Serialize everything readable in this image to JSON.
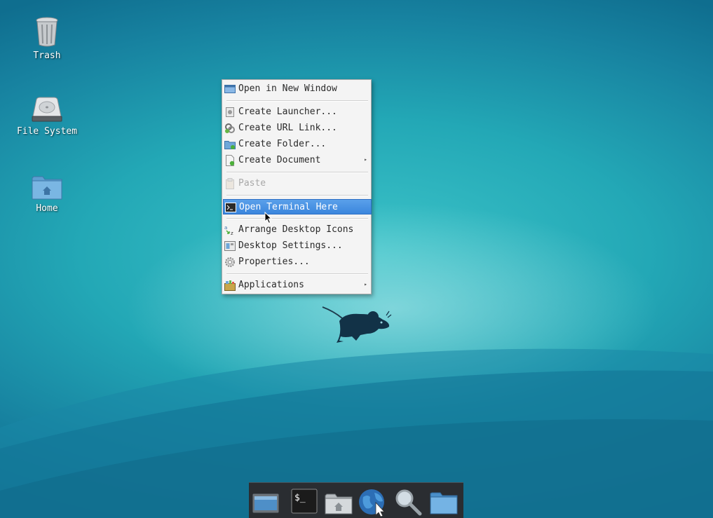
{
  "desktop_icons": [
    {
      "label": "Trash",
      "icon": "trash-icon"
    },
    {
      "label": "File System",
      "icon": "hard-drive-icon"
    },
    {
      "label": "Home",
      "icon": "home-folder-icon"
    }
  ],
  "context_menu": {
    "items": [
      {
        "label": "Open in New Window",
        "icon": "window-icon"
      },
      {
        "label": "Create Launcher...",
        "icon": "launcher-icon"
      },
      {
        "label": "Create URL Link...",
        "icon": "link-icon"
      },
      {
        "label": "Create Folder...",
        "icon": "folder-add-icon"
      },
      {
        "label": "Create Document",
        "icon": "document-add-icon",
        "submenu": true
      },
      {
        "label": "Paste",
        "icon": "paste-icon",
        "disabled": true
      },
      {
        "label": "Open Terminal Here",
        "icon": "terminal-icon",
        "highlighted": true
      },
      {
        "label": "Arrange Desktop Icons",
        "icon": "sort-az-icon"
      },
      {
        "label": "Desktop Settings...",
        "icon": "desktop-settings-icon"
      },
      {
        "label": "Properties...",
        "icon": "gear-icon"
      },
      {
        "label": "Applications",
        "icon": "applications-icon",
        "submenu": true
      }
    ],
    "submenu_arrow": "▸"
  },
  "dock": {
    "items": [
      {
        "icon": "show-desktop-icon"
      },
      {
        "icon": "terminal-icon",
        "label": "$_"
      },
      {
        "icon": "home-folder-icon"
      },
      {
        "icon": "web-browser-icon"
      },
      {
        "icon": "search-icon"
      },
      {
        "icon": "folder-icon"
      }
    ]
  },
  "colors": {
    "highlight": "#3b86dd",
    "desktop": "#23a8b6",
    "dock": "#2a2d31"
  }
}
